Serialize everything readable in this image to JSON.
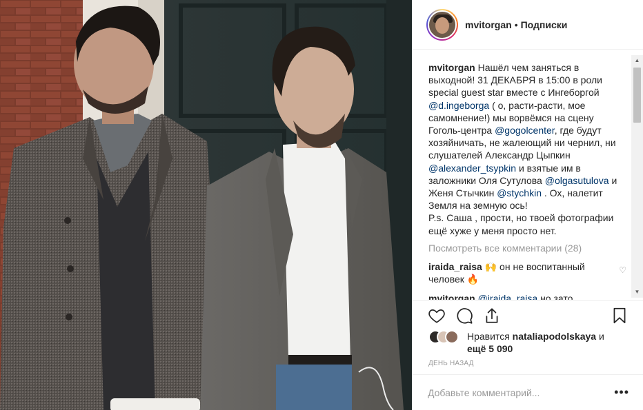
{
  "post": {
    "username": "mvitorgan",
    "separator": "•",
    "follow_label": "Подписки"
  },
  "caption": {
    "author": "mvitorgan",
    "p1": "Нашёл чем заняться в выходной! 31 ДЕКАБРЯ в 15:00 в роли special guest star вместе с Ингеборгой",
    "m1": "@d.ingeborga",
    "p2": "( о, расти-расти, мое самомнение!) мы ворвёмся на сцену Гоголь-центра",
    "m2": "@gogolcenter",
    "p3": ", где будут хозяйничать, не жалеющий ни чернил, ни слушателей Александр Цыпкин",
    "m3": "@alexander_tsypkin",
    "p4": "и взятые им в заложники Оля Сутулова",
    "m4": "@olgasutulova",
    "p5": "и Женя Стычкин",
    "m5": "@stychkin",
    "p6": ". Ох, налетит Земля на земную ось!",
    "ps": "P.s. Саша , прости, но твоей фотографии ещё хуже у меня просто нет."
  },
  "view_all_comments": "Посмотреть все комментарии (28)",
  "comments": [
    {
      "author": "iraida_raisa",
      "text": "🙌 он не воспитанный человек 🔥"
    },
    {
      "author": "mvitorgan",
      "mention": "@iraida_raisa",
      "text": "но зато"
    }
  ],
  "icons": {
    "like": "heart-outline-icon",
    "comment": "speech-bubble-icon",
    "share": "share-upload-icon",
    "save": "bookmark-icon",
    "comment_like": "♡",
    "scroll_up": "▲",
    "scroll_down": "▼"
  },
  "likes": {
    "prefix": "Нравится",
    "user": "nataliapodolskaya",
    "middle": "и",
    "count": "ещё 5 090"
  },
  "timestamp": "ДЕНЬ НАЗАД",
  "add_comment": {
    "placeholder": "Добавьте комментарий...",
    "more": "•••"
  },
  "colors": {
    "accent_link": "#003569",
    "muted": "#999999",
    "text": "#262626",
    "border": "#efefef"
  }
}
